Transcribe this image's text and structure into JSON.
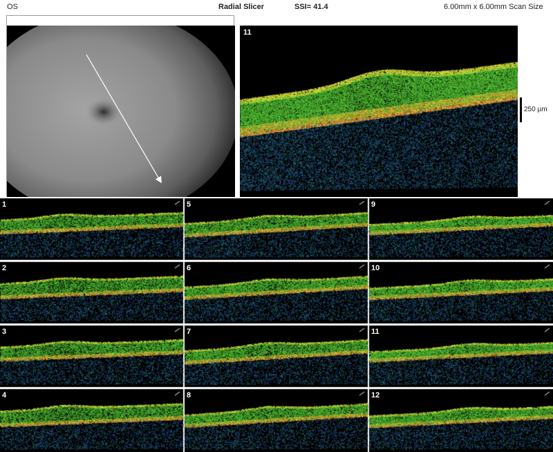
{
  "header": {
    "eye": "OS",
    "mode": "Radial Slicer",
    "ssi": "SSI= 41.4",
    "scan_size": "6.00mm x 6.00mm Scan Size"
  },
  "main_scan": {
    "label": "11",
    "scale_label": "250 µm"
  },
  "thumbnails": [
    {
      "label": "1"
    },
    {
      "label": "5"
    },
    {
      "label": "9"
    },
    {
      "label": "2"
    },
    {
      "label": "6"
    },
    {
      "label": "10"
    },
    {
      "label": "3"
    },
    {
      "label": "7"
    },
    {
      "label": "11"
    },
    {
      "label": "4"
    },
    {
      "label": "8"
    },
    {
      "label": "12"
    }
  ],
  "colors": {
    "scan_bg": "#000000",
    "retina_green": "#3fae30",
    "rpe_yellow": "#e8d640",
    "rpe_red": "#e44a1c",
    "noise_blue": "#2c5aa8"
  }
}
